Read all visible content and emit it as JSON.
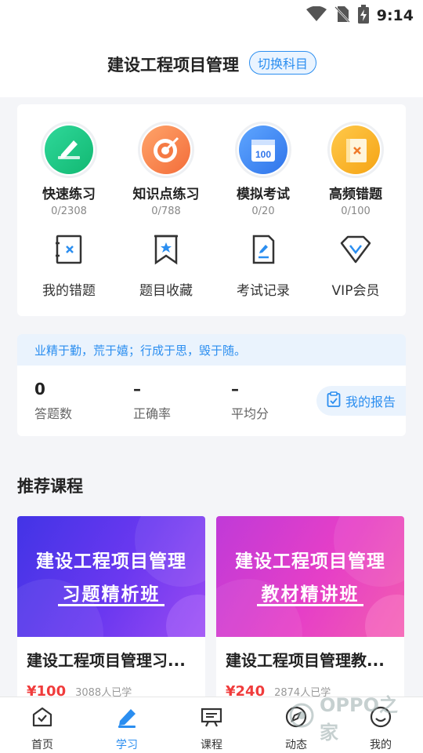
{
  "status": {
    "time": "9:14"
  },
  "header": {
    "title": "建设工程项目管理",
    "switch_label": "切换科目"
  },
  "practice": [
    {
      "label": "快速练习",
      "count": "0/2308",
      "icon": "pencil-icon"
    },
    {
      "label": "知识点练习",
      "count": "0/788",
      "icon": "target-icon"
    },
    {
      "label": "模拟考试",
      "count": "0/20",
      "icon": "calendar-100-icon"
    },
    {
      "label": "高频错题",
      "count": "0/100",
      "icon": "wrong-book-icon"
    }
  ],
  "tools": [
    {
      "label": "我的错题",
      "icon": "wrong-questions-icon"
    },
    {
      "label": "题目收藏",
      "icon": "bookmark-icon"
    },
    {
      "label": "考试记录",
      "icon": "exam-record-icon"
    },
    {
      "label": "VIP会员",
      "icon": "diamond-icon"
    }
  ],
  "motto": "业精于勤，荒于嬉；行成于思，毁于随。",
  "stats": [
    {
      "value": "0",
      "label": "答题数"
    },
    {
      "value": "–",
      "label": "正确率"
    },
    {
      "value": "–",
      "label": "平均分"
    }
  ],
  "report_label": "我的报告",
  "section_title": "推荐课程",
  "courses": [
    {
      "banner_line1": "建设工程项目管理",
      "banner_line2": "习题精析班",
      "title": "建设工程项目管理习...",
      "price": "¥100",
      "learners": "3088人已学"
    },
    {
      "banner_line1": "建设工程项目管理",
      "banner_line2": "教材精讲班",
      "title": "建设工程项目管理教...",
      "price": "¥240",
      "learners": "2874人已学"
    }
  ],
  "tabs": [
    {
      "label": "首页",
      "icon": "home-icon"
    },
    {
      "label": "学习",
      "icon": "study-icon"
    },
    {
      "label": "课程",
      "icon": "course-icon"
    },
    {
      "label": "动态",
      "icon": "compass-icon"
    },
    {
      "label": "我的",
      "icon": "profile-icon"
    }
  ],
  "watermark": "OPPO之家",
  "colors": {
    "accent": "#2b8ef0",
    "price": "#f03c3c",
    "background": "#f4f5f8"
  }
}
